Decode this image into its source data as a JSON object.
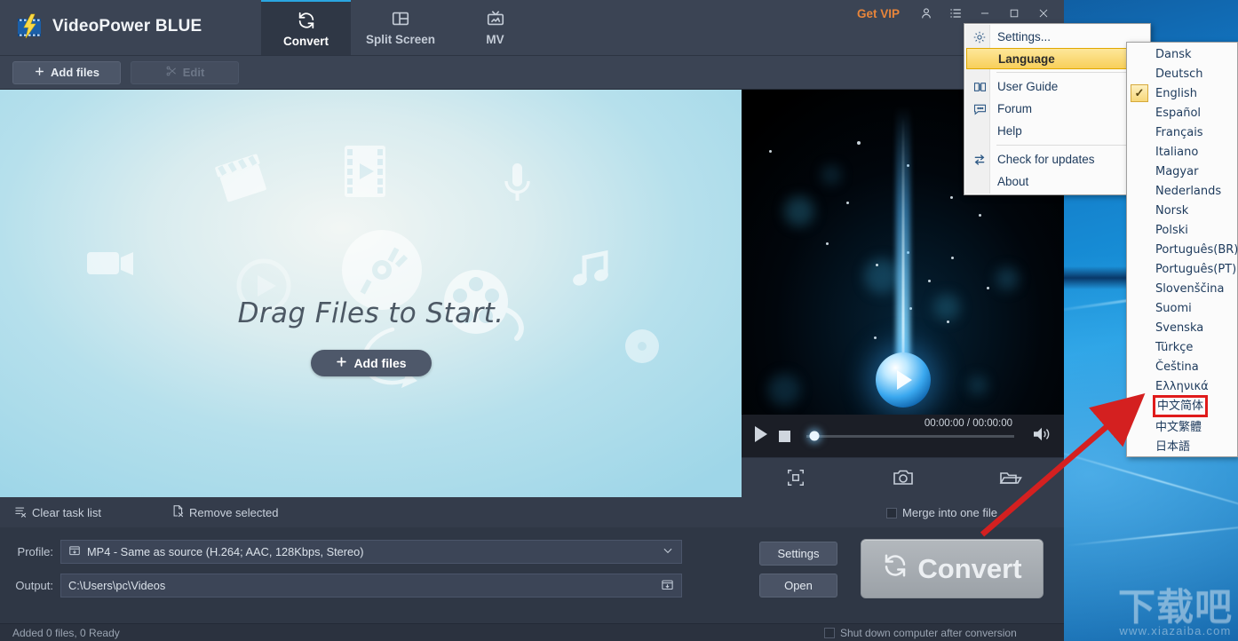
{
  "app": {
    "title": "VideoPower BLUE",
    "logo_icon": "video-power-logo-icon"
  },
  "titlebar": {
    "tabs": [
      {
        "label": "Convert",
        "icon": "convert-refresh-icon",
        "active": true
      },
      {
        "label": "Split Screen",
        "icon": "split-screen-icon",
        "active": false
      },
      {
        "label": "MV",
        "icon": "mv-tv-icon",
        "active": false
      }
    ],
    "get_vip": "Get VIP",
    "account_icon": "user-account-icon",
    "menu_icon": "hamburger-list-icon",
    "minimize_icon": "minimize-icon",
    "maximize_icon": "maximize-icon",
    "close_icon": "close-icon"
  },
  "toolbar": {
    "add_files": "Add files",
    "edit": "Edit",
    "add_icon": "plus-icon",
    "edit_icon": "scissors-icon"
  },
  "droparea": {
    "message": "Drag Files to Start.",
    "add_files": "Add files",
    "add_icon": "plus-icon"
  },
  "preview": {
    "time": "00:00:00 / 00:00:00",
    "play_icon": "play-icon",
    "stop_icon": "stop-icon",
    "volume_icon": "volume-on-icon",
    "seek_position_percent": 4,
    "tools": [
      {
        "icon": "crop-frame-icon",
        "name": "crop-button"
      },
      {
        "icon": "camera-snapshot-icon",
        "name": "snapshot-button"
      },
      {
        "icon": "open-folder-icon",
        "name": "open-folder-button"
      }
    ]
  },
  "taskbar": {
    "clear_task_list": "Clear task list",
    "clear_icon": "clear-list-icon",
    "remove_selected": "Remove selected",
    "remove_icon": "remove-file-icon",
    "merge_into_one_file": "Merge into one file",
    "merge_checked": false
  },
  "settings": {
    "profile_label": "Profile:",
    "profile_value": "MP4 - Same as source (H.264; AAC, 128Kbps, Stereo)",
    "profile_icon": "profile-folder-icon",
    "profile_dropdown_icon": "chevron-down-icon",
    "output_label": "Output:",
    "output_value": "C:\\Users\\pc\\Videos",
    "output_browse_icon": "browse-folder-icon",
    "settings_button": "Settings",
    "open_button": "Open",
    "convert_button": "Convert",
    "convert_icon": "convert-refresh-icon"
  },
  "statusbar": {
    "left_text": "Added 0 files, 0 Ready",
    "right_text": "Shut down computer after conversion",
    "right_checked": false
  },
  "main_menu": {
    "items": [
      {
        "label": "Settings...",
        "icon": "gear-icon",
        "selected": false,
        "submenu": false
      },
      {
        "label": "Language",
        "icon": "",
        "selected": true,
        "submenu": true
      },
      {
        "sep": true
      },
      {
        "label": "User Guide",
        "icon": "book-icon",
        "selected": false,
        "submenu": false
      },
      {
        "label": "Forum",
        "icon": "chat-bubble-icon",
        "selected": false,
        "submenu": false
      },
      {
        "label": "Help",
        "icon": "",
        "selected": false,
        "submenu": true
      },
      {
        "sep": true
      },
      {
        "label": "Check for updates",
        "icon": "sync-arrows-icon",
        "selected": false,
        "submenu": false
      },
      {
        "label": "About",
        "icon": "",
        "selected": false,
        "submenu": false
      }
    ]
  },
  "language_menu": {
    "items": [
      {
        "label": "Dansk",
        "checked": false,
        "highlighted": false
      },
      {
        "label": "Deutsch",
        "checked": false,
        "highlighted": false
      },
      {
        "label": "English",
        "checked": true,
        "highlighted": false
      },
      {
        "label": "Español",
        "checked": false,
        "highlighted": false
      },
      {
        "label": "Français",
        "checked": false,
        "highlighted": false
      },
      {
        "label": "Italiano",
        "checked": false,
        "highlighted": false
      },
      {
        "label": "Magyar",
        "checked": false,
        "highlighted": false
      },
      {
        "label": "Nederlands",
        "checked": false,
        "highlighted": false
      },
      {
        "label": "Norsk",
        "checked": false,
        "highlighted": false
      },
      {
        "label": "Polski",
        "checked": false,
        "highlighted": false
      },
      {
        "label": "Português(BR)",
        "checked": false,
        "highlighted": false
      },
      {
        "label": "Português(PT)",
        "checked": false,
        "highlighted": false
      },
      {
        "label": "Slovenščina",
        "checked": false,
        "highlighted": false
      },
      {
        "label": "Suomi",
        "checked": false,
        "highlighted": false
      },
      {
        "label": "Svenska",
        "checked": false,
        "highlighted": false
      },
      {
        "label": "Türkçe",
        "checked": false,
        "highlighted": false
      },
      {
        "label": "Čeština",
        "checked": false,
        "highlighted": false
      },
      {
        "label": "Ελληνικά",
        "checked": false,
        "highlighted": false
      },
      {
        "label": "中文简体",
        "checked": false,
        "highlighted": true
      },
      {
        "label": "中文繁體",
        "checked": false,
        "highlighted": false
      },
      {
        "label": "日本語",
        "checked": false,
        "highlighted": false
      }
    ],
    "check_glyph": "✓"
  },
  "watermark": {
    "cn": "下载吧",
    "url": "www.xiazaiba.com"
  },
  "colors": {
    "accent": "#2aa5e0",
    "vip": "#e8853a",
    "menu_highlight": "#f8cf5a",
    "annotation": "#e01b1b",
    "window_bg": "#2f3745"
  }
}
